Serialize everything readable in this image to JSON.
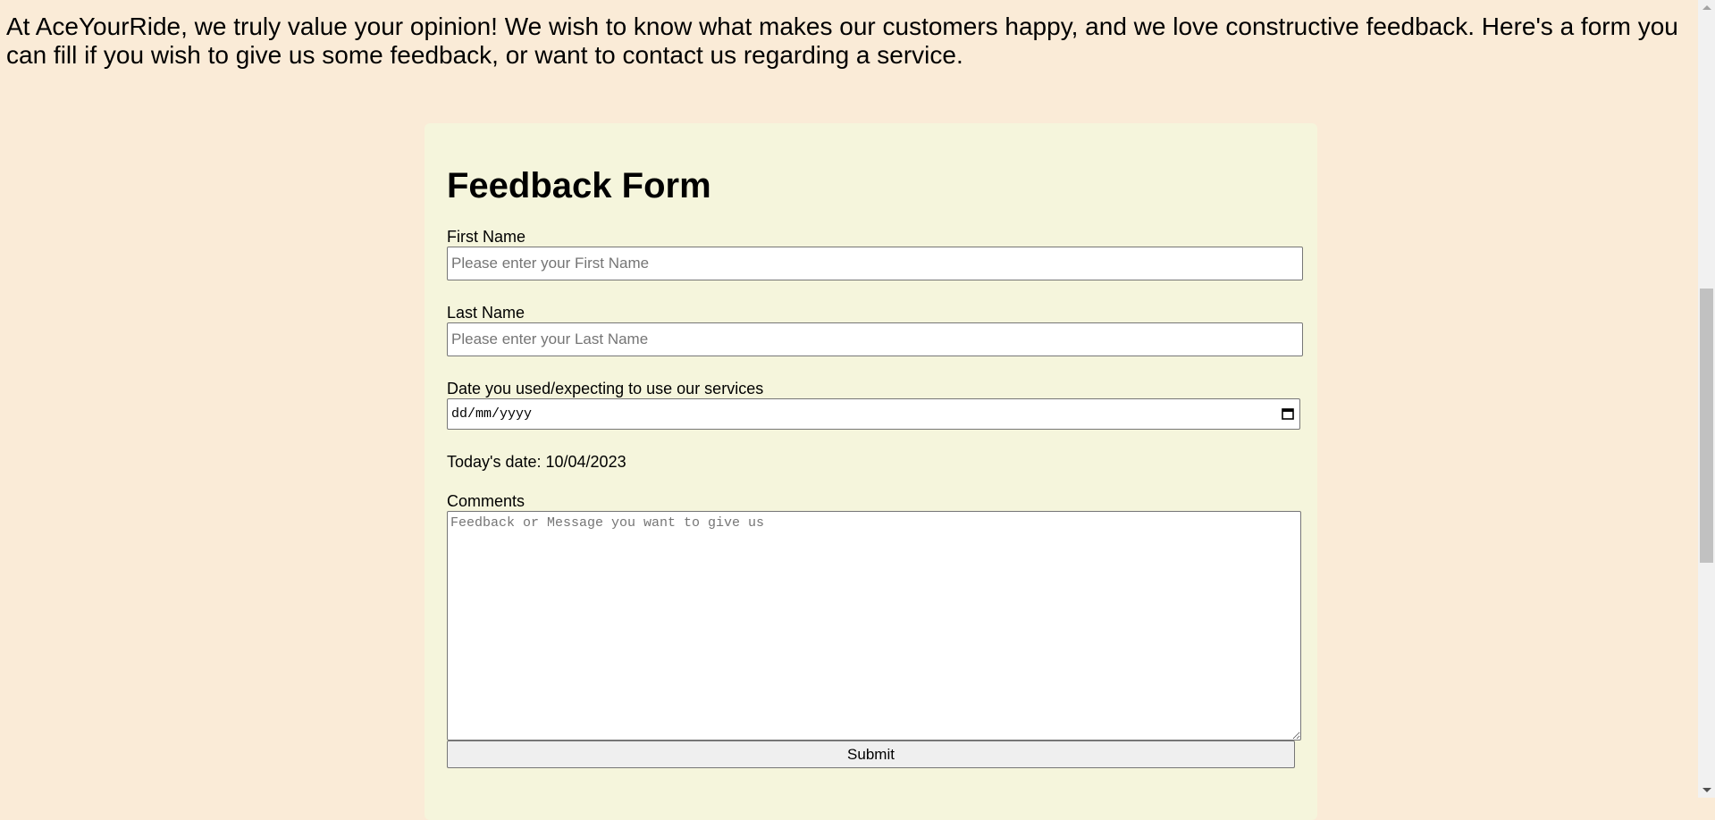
{
  "intro": {
    "text": "At AceYourRide, we truly value your opinion! We wish to know what makes our customers happy, and we love constructive feedback. Here's a form you can fill if you wish to give us some feedback, or want to contact us regarding a service."
  },
  "form": {
    "title": "Feedback Form",
    "first_name": {
      "label": "First Name",
      "value": "",
      "placeholder": "Please enter your First Name"
    },
    "last_name": {
      "label": "Last Name",
      "value": "",
      "placeholder": "Please enter your Last Name"
    },
    "date": {
      "label": "Date you used/expecting to use our services",
      "display": "dd/mm/yyyy",
      "icon": "calendar-icon"
    },
    "today": "Today's date: 10/04/2023",
    "comments": {
      "label": "Comments",
      "value": "",
      "placeholder": "Feedback or Message you want to give us"
    },
    "submit_label": "Submit"
  },
  "colors": {
    "page_background": "#faebd7",
    "card_background": "#f5f5dc",
    "button_background": "#efefef"
  }
}
